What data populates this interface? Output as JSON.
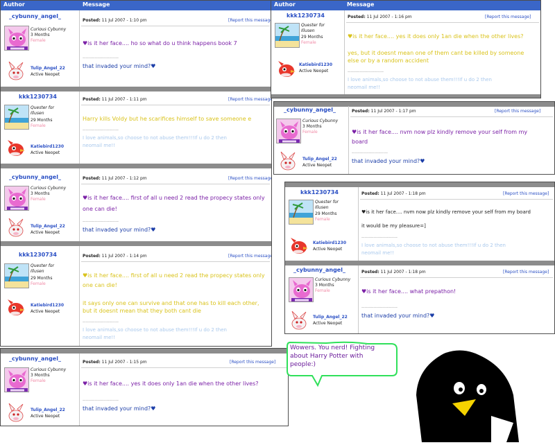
{
  "headers": {
    "author": "Author",
    "message": "Message"
  },
  "report_label": "[Report this message]",
  "posted_label": "Posted:",
  "separator": "------------------------",
  "users": {
    "angel": {
      "name": "_cybunny_angel_",
      "title": "Curious Cybunny",
      "age": "3 Months",
      "gender": "Female",
      "pet": "Tulip_Angel_22",
      "pet_type": "Active Neopet",
      "sig": "that invaded your mind?♥"
    },
    "kkk": {
      "name": "kkk1230734",
      "title_line1": "Quester for",
      "title_line2": "Illusen",
      "age": "29 Months",
      "gender": "Female",
      "pet": "Katiebird1230",
      "pet_type": "Active Neopet",
      "sig_line1": "I love animals,so choose to not abuse them!!!If u do 2 then",
      "sig_line2": "neomail me!!"
    }
  },
  "posts": [
    {
      "time": "11 Jul 2007 - 1:10 pm",
      "lines": [
        "♥is it her face.... ho so what do u think happens book 7"
      ]
    },
    {
      "time": "11 Jul 2007 - 1:11 pm",
      "lines": [
        "Harry kills Voldy but he scarifices himself to save someone e"
      ]
    },
    {
      "time": "11 Jul 2007 - 1:12 pm",
      "lines": [
        "♥is it her face.... first of all u need 2 read the propecy states only",
        "one can die!"
      ]
    },
    {
      "time": "11 Jul 2007 - 1:14 pm",
      "lines": [
        "♥is it her face.... first of all u need 2 read the propecy states only",
        "one can die!",
        "it says only one can survive and that one has to kill each other,",
        "but it doesnt mean that they both cant die"
      ]
    },
    {
      "time": "11 Jul 2007 - 1:15 pm",
      "lines": [
        "♥is it her face.... yes it does only 1an die when the other lives?"
      ]
    },
    {
      "time": "11 Jul 2007 - 1:16 pm",
      "lines": [
        "♥is it her face.... yes it does only 1an die when the other lives?",
        "yes, but it doesnt mean one of them cant be killed by someone",
        "else or by a random accident"
      ]
    },
    {
      "time": "11 Jul 2007 - 1:17 pm",
      "lines": [
        "♥is it her face.... nvm now plz kindly remove your self from my",
        "board"
      ]
    },
    {
      "time": "11 Jul 2007 - 1:18 pm",
      "lines": [
        "♥is it her face.... nvm now plz kindly remove your self from my board",
        "it would be my pleasure=]"
      ]
    },
    {
      "time": "11 Jul 2007 - 1:18 pm",
      "lines": [
        "♥is it her face.... what prepathon!"
      ]
    }
  ],
  "bubble": {
    "line1": "Wowers. You nerd! Fighting",
    "line2": "about Harry Potter with",
    "line3": "people:)"
  },
  "colors": {
    "header": "#3a66c8",
    "purple": "#7a1fa6",
    "yellow": "#d9c21a",
    "bubble_border": "#2fe05a",
    "penguin_beak": "#f5d300"
  }
}
